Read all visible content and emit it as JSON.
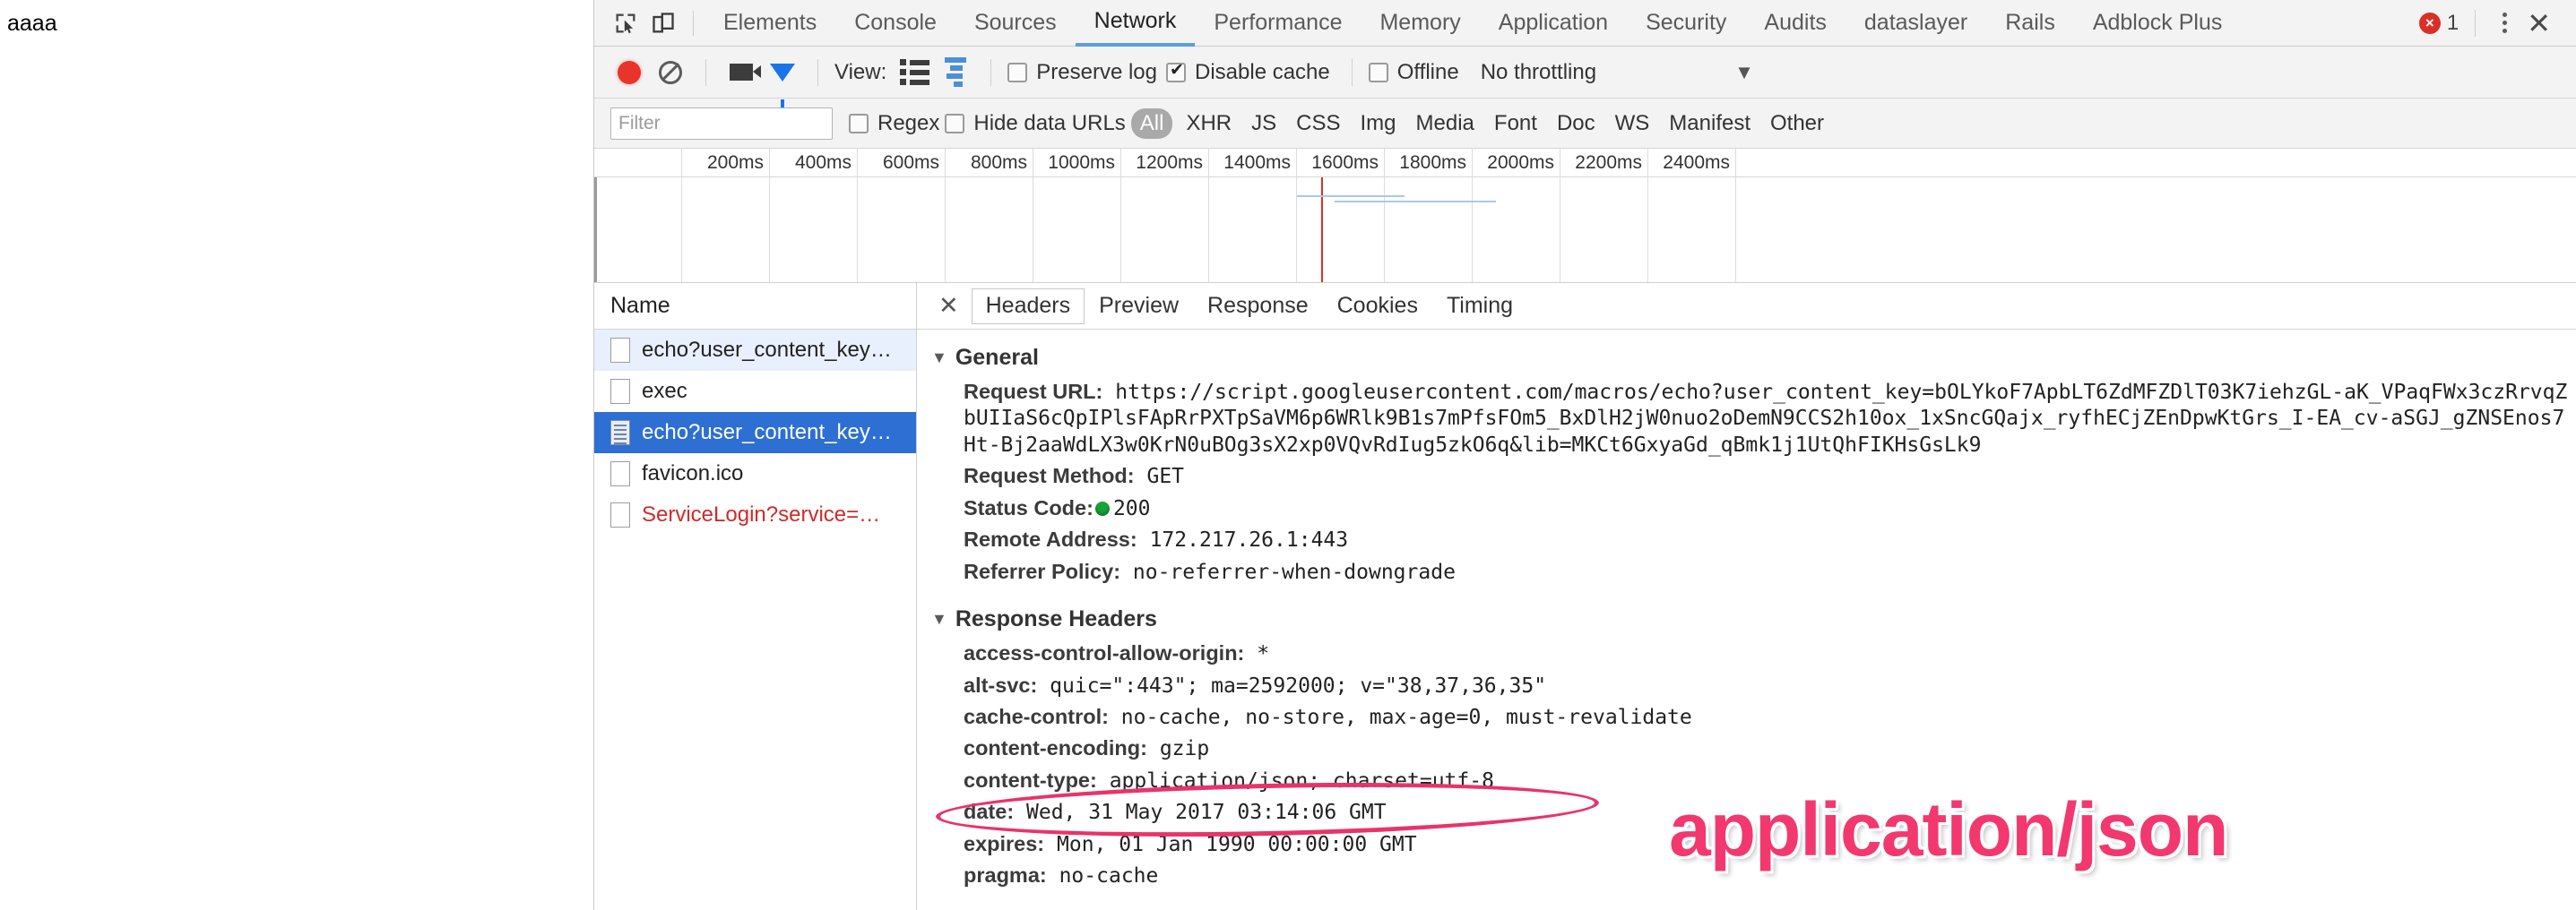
{
  "page": {
    "background_text": "aaaa"
  },
  "devtools": {
    "toolbar_icons": {
      "inspect": "inspect-element-icon",
      "device": "device-toolbar-icon"
    },
    "tabs": [
      {
        "label": "Elements",
        "active": false
      },
      {
        "label": "Console",
        "active": false
      },
      {
        "label": "Sources",
        "active": false
      },
      {
        "label": "Network",
        "active": true
      },
      {
        "label": "Performance",
        "active": false
      },
      {
        "label": "Memory",
        "active": false
      },
      {
        "label": "Application",
        "active": false
      },
      {
        "label": "Security",
        "active": false
      },
      {
        "label": "Audits",
        "active": false
      },
      {
        "label": "dataslayer",
        "active": false
      },
      {
        "label": "Rails",
        "active": false
      },
      {
        "label": "Adblock Plus",
        "active": false
      }
    ],
    "error_count": "1",
    "menu_icon": "more-vertical-icon",
    "close_icon": "close-icon"
  },
  "network_toolbar": {
    "record_title": "record-button",
    "clear_title": "clear-button",
    "capture_screenshots_title": "capture-screenshots-button",
    "filter_toggle_title": "filter-toggle-button",
    "view_label": "View:",
    "preserve_log": {
      "label": "Preserve log",
      "checked": false
    },
    "disable_cache": {
      "label": "Disable cache",
      "checked": true
    },
    "offline": {
      "label": "Offline",
      "checked": false
    },
    "throttling": {
      "value": "No throttling"
    }
  },
  "filter_bar": {
    "filter_placeholder": "Filter",
    "filter_value": "",
    "regex": {
      "label": "Regex",
      "checked": false
    },
    "hide_data_urls": {
      "label": "Hide data URLs",
      "checked": false
    },
    "types": [
      {
        "label": "All",
        "active": true
      },
      {
        "label": "XHR",
        "active": false
      },
      {
        "label": "JS",
        "active": false
      },
      {
        "label": "CSS",
        "active": false
      },
      {
        "label": "Img",
        "active": false
      },
      {
        "label": "Media",
        "active": false
      },
      {
        "label": "Font",
        "active": false
      },
      {
        "label": "Doc",
        "active": false
      },
      {
        "label": "WS",
        "active": false
      },
      {
        "label": "Manifest",
        "active": false
      },
      {
        "label": "Other",
        "active": false
      }
    ]
  },
  "overview": {
    "ticks": [
      "200ms",
      "400ms",
      "600ms",
      "800ms",
      "1000ms",
      "1200ms",
      "1400ms",
      "1600ms",
      "1800ms",
      "2000ms",
      "2200ms",
      "2400ms"
    ]
  },
  "request_list": {
    "column_header": "Name",
    "rows": [
      {
        "name": "echo?user_content_key…",
        "state": "alt",
        "icon": "blank-file-icon"
      },
      {
        "name": "exec",
        "state": "normal",
        "icon": "blank-file-icon"
      },
      {
        "name": "echo?user_content_key…",
        "state": "selected",
        "icon": "document-file-icon"
      },
      {
        "name": "favicon.ico",
        "state": "normal",
        "icon": "blank-file-icon"
      },
      {
        "name": "ServiceLogin?service=…",
        "state": "error",
        "icon": "blank-file-icon"
      }
    ]
  },
  "details": {
    "close_icon": "close-icon",
    "tabs": [
      {
        "label": "Headers",
        "active": true
      },
      {
        "label": "Preview",
        "active": false
      },
      {
        "label": "Response",
        "active": false
      },
      {
        "label": "Cookies",
        "active": false
      },
      {
        "label": "Timing",
        "active": false
      }
    ],
    "general": {
      "title": "General",
      "request_url_label": "Request URL:",
      "request_url_value": "https://script.googleusercontent.com/macros/echo?user_content_key=bOLYkoF7ApbLT6ZdMFZDlT03K7iehzGL-aK_VPaqFWx3czRrvqZbUIIaS6cQpIPlsFApRrPXTpSaVM6p6WRlk9B1s7mPfsFOm5_BxDlH2jW0nuo2oDemN9CCS2h10ox_1xSncGQajx_ryfhECjZEnDpwKtGrs_I-EA_cv-aSGJ_gZNSEnos7Ht-Bj2aaWdLX3w0KrN0uBOg3sX2xp0VQvRdIug5zkO6q&lib=MKCt6GxyaGd_qBmk1j1UtQhFIKHsGsLk9",
      "rows": [
        {
          "label": "Request Method:",
          "value": "GET"
        },
        {
          "label": "Status Code:",
          "value": "200",
          "status_dot": "#1aa33a"
        },
        {
          "label": "Remote Address:",
          "value": "172.217.26.1:443"
        },
        {
          "label": "Referrer Policy:",
          "value": "no-referrer-when-downgrade"
        }
      ]
    },
    "response_headers": {
      "title": "Response Headers",
      "rows": [
        {
          "label": "access-control-allow-origin:",
          "value": "*"
        },
        {
          "label": "alt-svc:",
          "value": "quic=\":443\"; ma=2592000; v=\"38,37,36,35\""
        },
        {
          "label": "cache-control:",
          "value": "no-cache, no-store, max-age=0, must-revalidate"
        },
        {
          "label": "content-encoding:",
          "value": "gzip"
        },
        {
          "label": "content-type:",
          "value": "application/json; charset=utf-8",
          "highlighted": true
        },
        {
          "label": "date:",
          "value": "Wed, 31 May 2017 03:14:06 GMT"
        },
        {
          "label": "expires:",
          "value": "Mon, 01 Jan 1990 00:00:00 GMT"
        },
        {
          "label": "pragma:",
          "value": "no-cache"
        }
      ]
    }
  },
  "annotation": {
    "text": "application/json",
    "color": "#f2386f",
    "ellipse_color": "#e8336b"
  }
}
